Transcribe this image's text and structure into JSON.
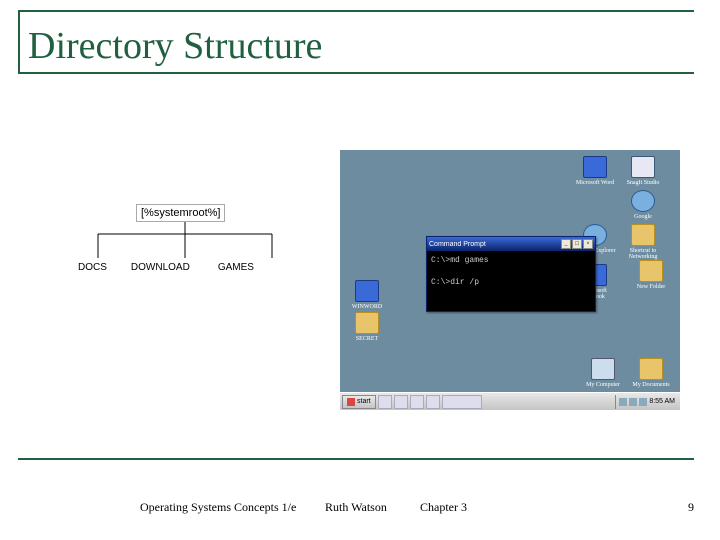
{
  "title": "Directory Structure",
  "footer": {
    "book": "Operating Systems Concepts 1/e",
    "author": "Ruth Watson",
    "chapter": "Chapter 3",
    "page": "9"
  },
  "tree": {
    "root": "[%systemroot%]",
    "leaves": [
      "DOCS",
      "DOWNLOAD",
      "GAMES"
    ]
  },
  "desktop": {
    "icons_right": [
      {
        "label": "Microsoft Word",
        "cls": "blue"
      },
      {
        "label": "SnagIt Studio",
        "cls": ""
      },
      {
        "label": "Google",
        "cls": "globe"
      },
      {
        "label": "Internet Explorer",
        "cls": "globe"
      },
      {
        "label": "Shortcut to Networking",
        "cls": "folder"
      },
      {
        "label": "Microsoft Outlook",
        "cls": "blue"
      },
      {
        "label": "New Folder",
        "cls": "folder"
      }
    ],
    "icons_left": [
      {
        "label": "WINWORD",
        "cls": "blue"
      },
      {
        "label": "SECRET",
        "cls": "folder"
      }
    ],
    "icons_bottom": [
      {
        "label": "My Computer",
        "cls": "comp"
      },
      {
        "label": "My Documents",
        "cls": "folder"
      }
    ]
  },
  "cmd": {
    "title": "Command Prompt",
    "lines": "C:\\>md games\n\nC:\\>dir /p"
  },
  "taskbar": {
    "start": "start",
    "clock": "8:55 AM"
  }
}
